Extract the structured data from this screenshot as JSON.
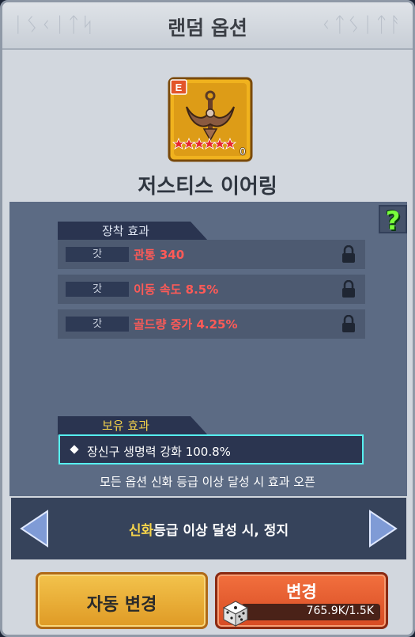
{
  "header": {
    "title": "랜덤 옵션"
  },
  "item": {
    "grade": "E",
    "level": "0",
    "name": "저스티스 이어링"
  },
  "help": {
    "symbol": "?"
  },
  "equip_effect": {
    "tab_label": "장착 효과",
    "options": [
      {
        "tag": "갓",
        "text": "관통 340"
      },
      {
        "tag": "갓",
        "text": "이동 속도 8.5%"
      },
      {
        "tag": "갓",
        "text": "골드량 증가 4.25%"
      }
    ]
  },
  "owned_effect": {
    "tab_label": "보유 효과",
    "text": "장신구 생명력 강화 100.8%"
  },
  "note": "모든 옵션 신화 등급 이상 달성 시 효과 오픈",
  "nav": {
    "highlight": "신화",
    "rest": "등급 이상 달성 시, 정지"
  },
  "buttons": {
    "auto_change": "자동 변경",
    "change": "변경",
    "cost": "765.9K/1.5K"
  },
  "colors": {
    "option_text": "#ff5a57",
    "highlight": "#f6d44b",
    "owned_border": "#56f0f0"
  }
}
